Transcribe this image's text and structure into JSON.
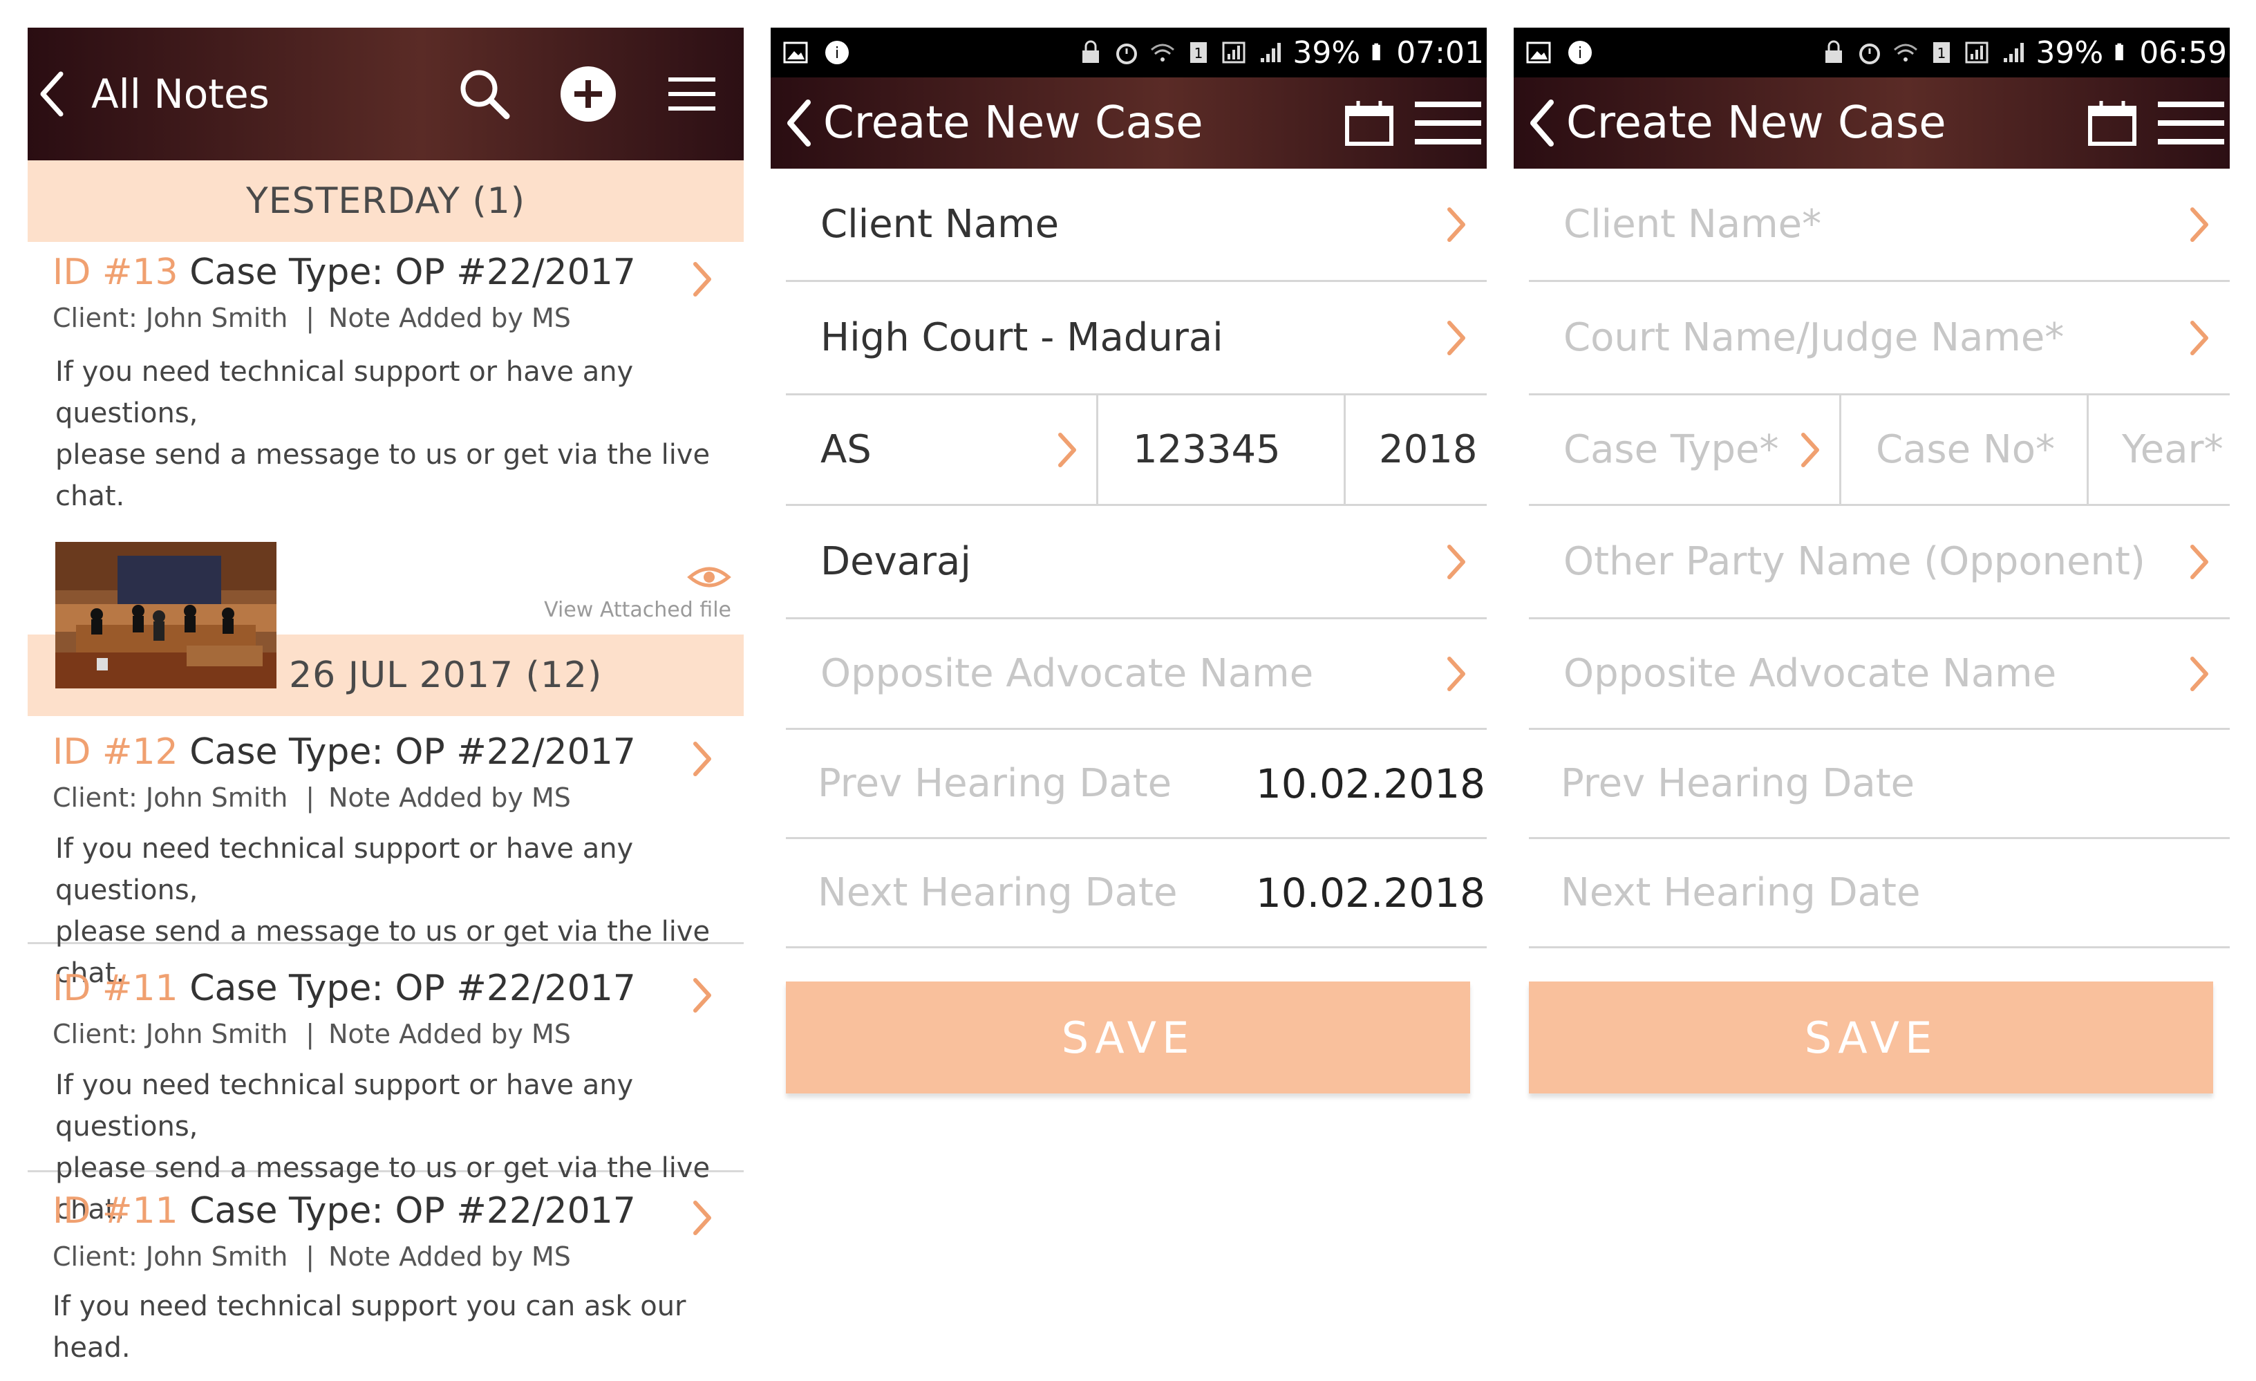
{
  "panel1": {
    "header": {
      "back_icon": "chevron-left-icon",
      "title": "All Notes",
      "search_icon": "search-icon",
      "add_icon": "plus-circle-icon",
      "menu_icon": "hamburger-menu-icon"
    },
    "sections": [
      {
        "label": "YESTERDAY (1)"
      },
      {
        "label": "FROM 26 JUL 2017 (12)"
      }
    ],
    "notes": [
      {
        "id": "ID #13",
        "case": "Case Type: OP #22/2017",
        "client": "Client: John Smith",
        "sep": "|",
        "added_by": "Note Added by MS",
        "body_line1": "If you need technical support or have any questions,",
        "body_line2": "please send a message to us or get via the live chat.",
        "attachment_label": "View Attached file"
      },
      {
        "id": "ID #12",
        "case": "Case Type: OP #22/2017",
        "client": "Client: John Smith",
        "sep": "|",
        "added_by": "Note Added by MS",
        "body_line1": "If you need technical support or have any questions,",
        "body_line2": "please send a message to us or get via the live chat."
      },
      {
        "id": "ID #11",
        "case": "Case Type: OP #22/2017",
        "client": "Client: John Smith",
        "sep": "|",
        "added_by": "Note Added by MS",
        "body_line1": "If you need technical support or have any questions,",
        "body_line2": "please send a message to us or get via the live chat."
      },
      {
        "id": "ID #11",
        "case": "Case Type: OP #22/2017",
        "client": "Client: John Smith",
        "sep": "|",
        "added_by": "Note Added by MS",
        "body_line1": "If you need technical support you can ask our head."
      }
    ]
  },
  "panel2": {
    "status": {
      "battery": "39%",
      "time": "07:01"
    },
    "header": {
      "title": "Create New Case",
      "calendar_icon": "calendar-icon",
      "menu_icon": "hamburger-menu-icon"
    },
    "client_name": "Client Name",
    "court_name": "High Court - Madurai",
    "case_type": "AS",
    "case_no": "123345",
    "year": "2018",
    "other_party": "Devaraj",
    "opposite_advocate_placeholder": "Opposite Advocate Name",
    "prev_hearing_label": "Prev Hearing Date",
    "prev_hearing_value": "10.02.2018",
    "next_hearing_label": "Next Hearing Date",
    "next_hearing_value": "10.02.2018",
    "save_label": "SAVE"
  },
  "panel3": {
    "status": {
      "battery": "39%",
      "time": "06:59"
    },
    "header": {
      "title": "Create New Case",
      "calendar_icon": "calendar-icon",
      "menu_icon": "hamburger-menu-icon"
    },
    "client_name_placeholder": "Client Name*",
    "court_name_placeholder": "Court Name/Judge Name*",
    "case_type_placeholder": "Case Type*",
    "case_no_placeholder": "Case No*",
    "year_placeholder": "Year*",
    "other_party_placeholder": "Other Party Name (Opponent)",
    "opposite_advocate_placeholder": "Opposite Advocate Name",
    "prev_hearing_label": "Prev Hearing Date",
    "next_hearing_label": "Next Hearing Date",
    "save_label": "SAVE"
  },
  "colors": {
    "accent": "#f0a070",
    "section_bg": "#fde0cb",
    "save_bg": "#f9c09c",
    "header_dark": "#2a0d12",
    "placeholder": "#c7c7c7"
  }
}
